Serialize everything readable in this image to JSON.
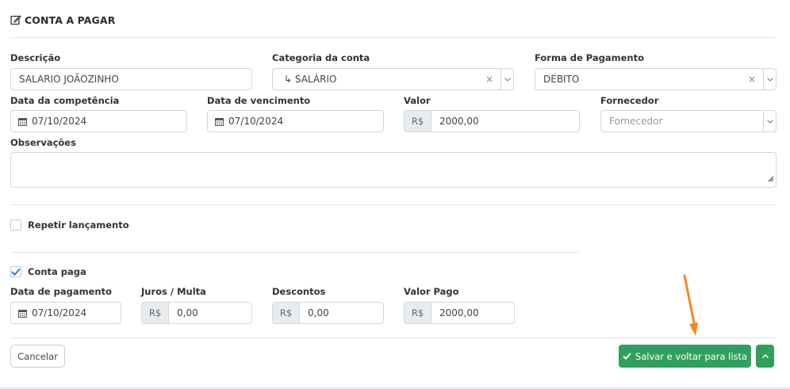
{
  "form": {
    "title": "CONTA A PAGAR",
    "descricao": {
      "label": "Descrição",
      "value": "SALARIO JOÃOZINHO"
    },
    "categoria": {
      "label": "Categoria da conta",
      "value": "↳ SALÁRIO",
      "clear": "×"
    },
    "forma_pagamento": {
      "label": "Forma de Pagamento",
      "value": "DÉBITO",
      "clear": "×"
    },
    "data_competencia": {
      "label": "Data da competência",
      "value": "07/10/2024"
    },
    "data_vencimento": {
      "label": "Data de vencimento",
      "value": "07/10/2024"
    },
    "valor": {
      "label": "Valor",
      "currency": "R$",
      "value": "2000,00"
    },
    "fornecedor": {
      "label": "Fornecedor",
      "placeholder": "Fornecedor"
    },
    "observacoes": {
      "label": "Observações",
      "value": ""
    },
    "repetir": {
      "label": "Repetir lançamento",
      "checked": false
    },
    "conta_paga": {
      "label": "Conta paga",
      "checked": true
    },
    "data_pagamento": {
      "label": "Data de pagamento",
      "value": "07/10/2024"
    },
    "juros": {
      "label": "Juros / Multa",
      "currency": "R$",
      "value": "0,00"
    },
    "descontos": {
      "label": "Descontos",
      "currency": "R$",
      "value": "0,00"
    },
    "valor_pago": {
      "label": "Valor Pago",
      "currency": "R$",
      "value": "2000,00"
    }
  },
  "actions": {
    "cancel_label": "Cancelar",
    "save_label": "Salvar e voltar para lista"
  },
  "colors": {
    "primary_green": "#31a05e",
    "checkbox_blue": "#2d7ec4",
    "annotation_arrow": "#f5891f"
  },
  "icons": [
    "edit-icon",
    "calendar-icon",
    "chevron-down-icon",
    "check-icon",
    "chevron-up-icon",
    "close-icon"
  ]
}
